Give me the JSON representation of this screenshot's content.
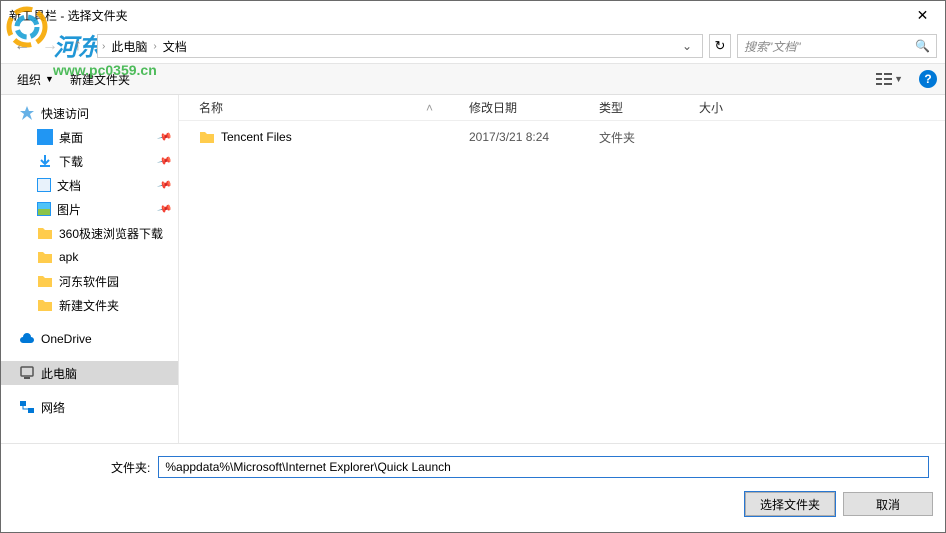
{
  "title": "新工具栏 - 选择文件夹",
  "watermark": {
    "text": "河东软件园",
    "url": "www.pc0359.cn"
  },
  "breadcrumb": {
    "items": [
      "此电脑",
      "文档"
    ]
  },
  "search": {
    "placeholder": "搜索\"文档\""
  },
  "toolbar": {
    "organize": "组织",
    "newfolder": "新建文件夹"
  },
  "columns": {
    "name": "名称",
    "date": "修改日期",
    "type": "类型",
    "size": "大小"
  },
  "sidebar": {
    "quick": "快速访问",
    "desktop": "桌面",
    "downloads": "下载",
    "documents": "文档",
    "pictures": "图片",
    "f1": "360极速浏览器下载",
    "f2": "apk",
    "f3": "河东软件园",
    "f4": "新建文件夹",
    "onedrive": "OneDrive",
    "thispc": "此电脑",
    "network": "网络"
  },
  "files": [
    {
      "name": "Tencent Files",
      "date": "2017/3/21 8:24",
      "type": "文件夹"
    }
  ],
  "footer": {
    "label": "文件夹:",
    "value": "%appdata%\\Microsoft\\Internet Explorer\\Quick Launch",
    "select": "选择文件夹",
    "cancel": "取消"
  }
}
